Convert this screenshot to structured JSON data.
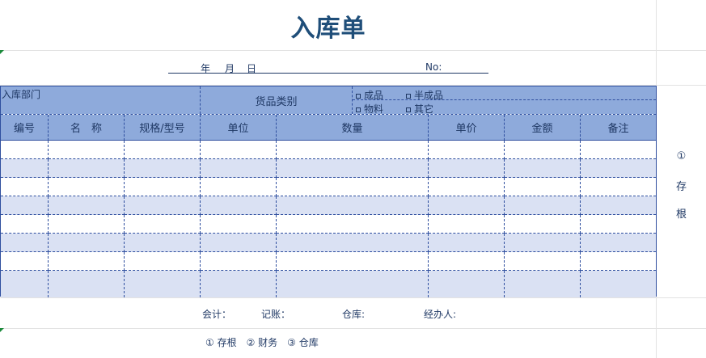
{
  "title": "入库单",
  "date": {
    "year": "年",
    "month": "月",
    "day": "日",
    "no_label": "No:"
  },
  "info": {
    "department_label": "入库部门",
    "category_label": "货品类别",
    "options": [
      "成品",
      "半成品",
      "物料",
      "其它"
    ]
  },
  "columns": [
    "编号",
    "名　称",
    "规格/型号",
    "单位",
    "数量",
    "单价",
    "金额",
    "备注"
  ],
  "rows": [
    [
      "",
      "",
      "",
      "",
      "",
      "",
      "",
      ""
    ],
    [
      "",
      "",
      "",
      "",
      "",
      "",
      "",
      ""
    ],
    [
      "",
      "",
      "",
      "",
      "",
      "",
      "",
      ""
    ],
    [
      "",
      "",
      "",
      "",
      "",
      "",
      "",
      ""
    ],
    [
      "",
      "",
      "",
      "",
      "",
      "",
      "",
      ""
    ],
    [
      "",
      "",
      "",
      "",
      "",
      "",
      "",
      ""
    ],
    [
      "",
      "",
      "",
      "",
      "",
      "",
      "",
      ""
    ],
    [
      "",
      "",
      "",
      "",
      "",
      "",
      "",
      ""
    ]
  ],
  "stub": {
    "number": "①",
    "chars": [
      "存",
      "根"
    ]
  },
  "signatures": {
    "accountant": "会计：",
    "bookkeeper": "记账：",
    "warehouse": "仓库:",
    "handler": "经办人:"
  },
  "copies": "① 存根　② 财务　③ 仓库",
  "colors": {
    "header_bg": "#8eaadb",
    "alt_row_bg": "#dae1f3",
    "border": "#2f4f9f",
    "text": "#1f3864"
  }
}
